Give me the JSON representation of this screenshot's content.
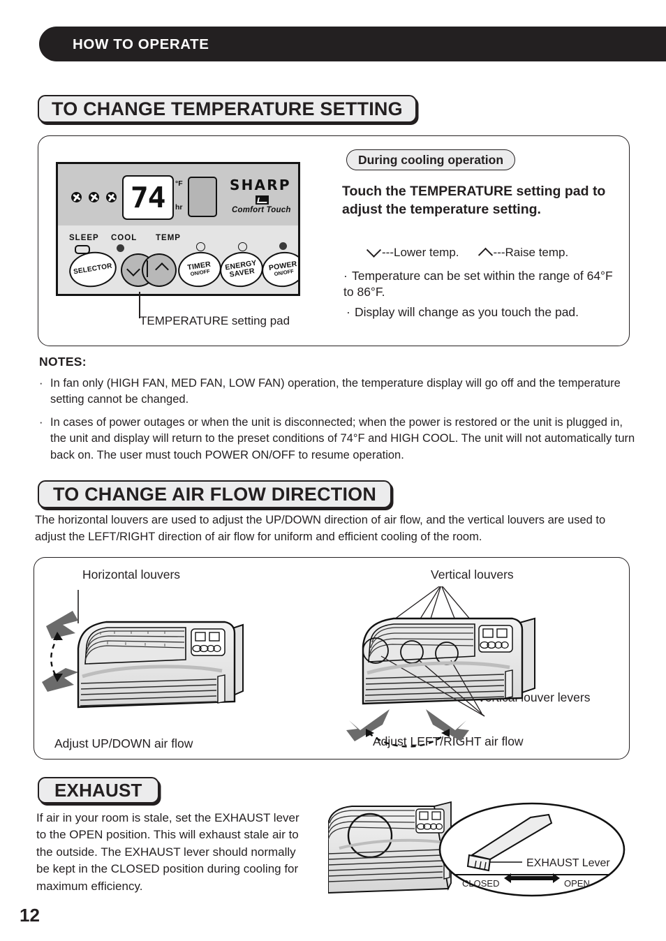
{
  "header": {
    "title": "HOW TO OPERATE"
  },
  "sections": {
    "temperature": {
      "title": "TO CHANGE TEMPERATURE SETTING"
    },
    "airflow": {
      "title": "TO CHANGE AIR FLOW DIRECTION"
    },
    "exhaust": {
      "title": "EXHAUST"
    }
  },
  "control_panel": {
    "display_value": "74",
    "unit_f": "°F",
    "unit_hr": "hr",
    "brand": "SHARP",
    "brand_tagline": "Comfort Touch",
    "indicator_labels": {
      "sleep": "SLEEP",
      "cool": "COOL",
      "temp": "TEMP"
    },
    "buttons": [
      {
        "label": "SELECTOR",
        "sub": ""
      },
      {
        "label": "TIMER",
        "sub": "ON/OFF"
      },
      {
        "label": "ENERGY",
        "sub": "SAVER"
      },
      {
        "label": "POWER",
        "sub": "ON/OFF"
      }
    ],
    "caption": "TEMPERATURE setting pad"
  },
  "cooling": {
    "badge": "During cooling operation",
    "instruction": "Touch the TEMPERATURE setting pad to adjust the temperature setting.",
    "lower_label": "---Lower temp.",
    "raise_label": "---Raise temp.",
    "bullets": [
      "Temperature can be set within the range of 64°F to 86°F.",
      "Display will change as you touch the pad."
    ]
  },
  "notes": {
    "heading": "NOTES:",
    "items": [
      "In fan only (HIGH FAN, MED FAN, LOW FAN) operation, the temperature display will go off and the temperature setting cannot be changed.",
      "In cases of power outages or when the unit is disconnected; when the power is restored or the unit is plugged in, the unit and display will return to the preset conditions of 74°F and HIGH COOL. The unit will not automatically turn back on.  The user must touch POWER ON/OFF to resume operation."
    ]
  },
  "airflow": {
    "intro": "The horizontal louvers are used to adjust the UP/DOWN direction of air flow, and the vertical louvers are used to adjust the LEFT/RIGHT direction of air flow for uniform and efficient  cooling  of  the  room.",
    "horizontal_label": "Horizontal louvers",
    "vertical_label": "Vertical louvers",
    "vertical_lever_label": "Vertical louver levers",
    "updown_caption": "Adjust UP/DOWN air flow",
    "leftright_caption": "Adjust LEFT/RIGHT air flow"
  },
  "exhaust": {
    "body": "If air in your room is stale, set the EXHAUST lever to the OPEN position.  This will exhaust stale air to the outside.  The EXHAUST lever should normally be kept in the CLOSED position during cooling for maximum efficiency.",
    "lever_label": "EXHAUST Lever",
    "closed_label": "CLOSED",
    "open_label": "OPEN"
  },
  "page_number": "12",
  "colors": {
    "ink": "#231f20",
    "panel_gray": "#c9c9c9",
    "pill_fill": "#ececed"
  }
}
